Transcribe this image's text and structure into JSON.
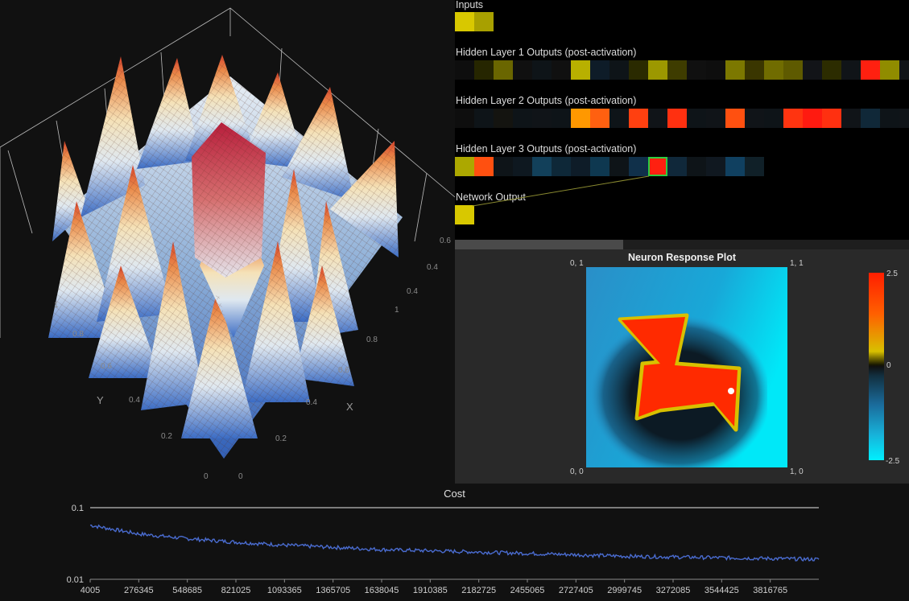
{
  "surface_plot": {
    "x_axis_label": "X",
    "y_axis_label": "Y",
    "x_ticks": [
      "0",
      "0.2",
      "0.4",
      "0.6",
      "0.8",
      "1"
    ],
    "y_ticks": [
      "0",
      "0.2",
      "0.4",
      "0.6",
      "0.8",
      "1"
    ],
    "colors": {
      "low": "#3b6cc4",
      "mid": "#f0f0f0",
      "high": "#e0442a",
      "peak": "#b81e3c"
    }
  },
  "layers": {
    "inputs": {
      "title": "Inputs",
      "cells": [
        "#d8c800",
        "#a8a000"
      ]
    },
    "hidden1": {
      "title": "Hidden Layer 1 Outputs (post-activation)",
      "cells": [
        "#0e0e0e",
        "#262600",
        "#6a6600",
        "#101010",
        "#0e1418",
        "#101010",
        "#b8b000",
        "#0e1c28",
        "#0e1418",
        "#2a2a00",
        "#9c9800",
        "#3e3c00",
        "#101010",
        "#0e0e0e",
        "#7c7800",
        "#3a3600",
        "#706c00",
        "#5e5a00",
        "#121418",
        "#2c2c00",
        "#101418",
        "#ff2010",
        "#908c00",
        "#101418"
      ]
    },
    "hidden2": {
      "title": "Hidden Layer 2 Outputs (post-activation)",
      "cells": [
        "#0e0e0e",
        "#0e1418",
        "#141410",
        "#0e1418",
        "#101418",
        "#0e1418",
        "#ff9800",
        "#ff6010",
        "#0e1418",
        "#ff4010",
        "#101418",
        "#ff3010",
        "#0e1418",
        "#101418",
        "#ff5010",
        "#101418",
        "#0e1418",
        "#ff3410",
        "#ff1a10",
        "#ff3010",
        "#101418",
        "#102838",
        "#0e1418",
        "#101418"
      ]
    },
    "hidden3": {
      "title": "Hidden Layer 3 Outputs (post-activation)",
      "cells": [
        "#aca800",
        "#ff5010",
        "#0e1418",
        "#0e1820",
        "#12405a",
        "#0e2838",
        "#0e1c28",
        "#0e3850",
        "#0e1418",
        "#10304a",
        "#ff2010",
        "#10283a",
        "#0e1418",
        "#101820",
        "#104060",
        "#102028"
      ],
      "selected_index": 10
    },
    "output": {
      "title": "Network Output",
      "cells": [
        "#d8c800"
      ]
    }
  },
  "scrollbar": {
    "position": 0.37
  },
  "response_plot": {
    "title": "Neuron Response Plot",
    "corner_top_left": "0, 1",
    "corner_top_right": "1, 1",
    "corner_bottom_left": "0, 0",
    "corner_bottom_right": "1, 0",
    "colorbar_max": "2.5",
    "colorbar_mid": "0",
    "colorbar_min": "-2.5"
  },
  "chart_data": {
    "type": "line",
    "title": "Cost",
    "y_scale": "log",
    "ylim": [
      0.01,
      0.1
    ],
    "y_ticks": [
      "0.1",
      "0.01"
    ],
    "x_ticks": [
      "4005",
      "276345",
      "548685",
      "821025",
      "1093365",
      "1365705",
      "1638045",
      "1910385",
      "2182725",
      "2455065",
      "2727405",
      "2999745",
      "3272085",
      "3544425",
      "3816765"
    ],
    "xlim": [
      4005,
      4089105
    ],
    "series": [
      {
        "color": "#4a6cd0",
        "x": [
          4005,
          276345,
          548685,
          821025,
          1093365,
          1365705,
          1638045,
          1910385,
          2182725,
          2455065,
          2727405,
          2999745,
          3272085,
          3544425,
          3816765,
          4089105
        ],
        "y": [
          0.057,
          0.043,
          0.037,
          0.033,
          0.03,
          0.028,
          0.026,
          0.025,
          0.024,
          0.023,
          0.022,
          0.021,
          0.0205,
          0.02,
          0.0195,
          0.019
        ]
      }
    ]
  }
}
